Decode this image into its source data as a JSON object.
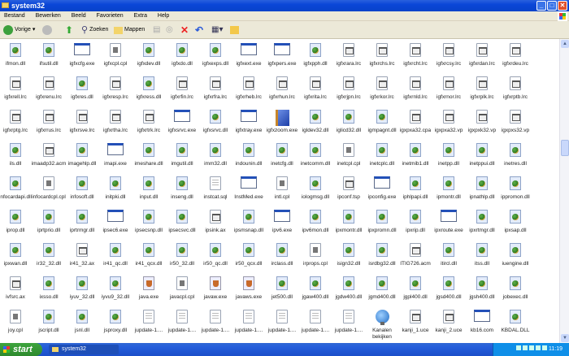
{
  "window": {
    "title": "system32"
  },
  "menu": [
    "Bestand",
    "Bewerken",
    "Beeld",
    "Favorieten",
    "Extra",
    "Help"
  ],
  "toolbar": {
    "back": "Vorige",
    "search": "Zoeken",
    "folders": "Mappen"
  },
  "taskbar": {
    "start": "start",
    "task": "system32",
    "clock": "11:19"
  },
  "rows": [
    [
      [
        "ifmon.dll",
        "dll"
      ],
      [
        "ifsutil.dll",
        "dll"
      ],
      [
        "igfxcfg.exe",
        "exe"
      ],
      [
        "igfxcpl.cpl",
        "cpl"
      ],
      [
        "igfxdev.dll",
        "dll"
      ],
      [
        "igfxdo.dll",
        "dll"
      ],
      [
        "igfxexps.dll",
        "dll"
      ],
      [
        "igfxext.exe",
        "exe"
      ],
      [
        "igfxpers.exe",
        "exe"
      ],
      [
        "igfxpph.dll",
        "dll"
      ],
      [
        "igfxrara.lrc",
        "lrc"
      ],
      [
        "igfxrchs.lrc",
        "lrc"
      ],
      [
        "igfxrcht.lrc",
        "lrc"
      ],
      [
        "igfxrcsy.lrc",
        "lrc"
      ],
      [
        "igfxrdan.lrc",
        "lrc"
      ],
      [
        "igfxrdeu.lrc",
        "lrc"
      ]
    ],
    [
      [
        "igfxrell.lrc",
        "lrc"
      ],
      [
        "igfxrenu.lrc",
        "lrc"
      ],
      [
        "igfxres.dll",
        "dll"
      ],
      [
        "igfxresp.lrc",
        "lrc"
      ],
      [
        "igfxress.dll",
        "dll"
      ],
      [
        "igfxrfin.lrc",
        "lrc"
      ],
      [
        "igfxrfra.lrc",
        "lrc"
      ],
      [
        "igfxrheb.lrc",
        "lrc"
      ],
      [
        "igfxrhun.lrc",
        "lrc"
      ],
      [
        "igfxrita.lrc",
        "lrc"
      ],
      [
        "igfxrjpn.lrc",
        "lrc"
      ],
      [
        "igfxrkor.lrc",
        "lrc"
      ],
      [
        "igfxrnld.lrc",
        "lrc"
      ],
      [
        "igfxrnor.lrc",
        "lrc"
      ],
      [
        "igfxrplk.lrc",
        "lrc"
      ],
      [
        "igfxrptb.lrc",
        "lrc"
      ]
    ],
    [
      [
        "igfxrptg.lrc",
        "lrc"
      ],
      [
        "igfxrrus.lrc",
        "lrc"
      ],
      [
        "igfxrsve.lrc",
        "lrc"
      ],
      [
        "igfxrtha.lrc",
        "lrc"
      ],
      [
        "igfxrtrk.lrc",
        "lrc"
      ],
      [
        "igfxsrvc.exe",
        "exe"
      ],
      [
        "igfxsrvc.dll",
        "dll"
      ],
      [
        "igfxtray.exe",
        "exe"
      ],
      [
        "igfxzoom.exe",
        "zoom"
      ],
      [
        "igldev32.dll",
        "dll"
      ],
      [
        "iglicd32.dll",
        "dll"
      ],
      [
        "igmpagnt.dll",
        "dll"
      ],
      [
        "igxpxa32.cpa",
        "lrc"
      ],
      [
        "igxpxa32.vp",
        "lrc"
      ],
      [
        "igxpxk32.vp",
        "lrc"
      ],
      [
        "igxpxs32.vp",
        "lrc"
      ]
    ],
    [
      [
        "ils.dll",
        "dll"
      ],
      [
        "imaadp32.acm",
        "lrc"
      ],
      [
        "imagehlp.dll",
        "dll"
      ],
      [
        "imapi.exe",
        "exe"
      ],
      [
        "imeshare.dll",
        "dll"
      ],
      [
        "imgutil.dll",
        "dll"
      ],
      [
        "imm32.dll",
        "dll"
      ],
      [
        "indounin.dll",
        "dll"
      ],
      [
        "inetcfg.dll",
        "dll"
      ],
      [
        "inetcomm.dll",
        "dll"
      ],
      [
        "inetcpl.cpl",
        "cpl"
      ],
      [
        "inetcplc.dll",
        "dll"
      ],
      [
        "inetmib1.dll",
        "dll"
      ],
      [
        "inetpp.dll",
        "dll"
      ],
      [
        "inetppui.dll",
        "dll"
      ],
      [
        "inetres.dll",
        "dll"
      ]
    ],
    [
      [
        "infocardapi.dll",
        "dll"
      ],
      [
        "infocardcpl.cpl",
        "cpl"
      ],
      [
        "infosoft.dll",
        "dll"
      ],
      [
        "initpki.dll",
        "dll"
      ],
      [
        "input.dll",
        "dll"
      ],
      [
        "inseng.dll",
        "dll"
      ],
      [
        "instcat.sql",
        "sql"
      ],
      [
        "InstMed.exe",
        "exe"
      ],
      [
        "intl.cpl",
        "cpl"
      ],
      [
        "iologmsg.dll",
        "dll"
      ],
      [
        "ipconf.tsp",
        "lrc"
      ],
      [
        "ipconfig.exe",
        "exe"
      ],
      [
        "iphlpapi.dll",
        "dll"
      ],
      [
        "ipmontr.dll",
        "dll"
      ],
      [
        "ipnathlp.dll",
        "dll"
      ],
      [
        "ippromon.dll",
        "dll"
      ]
    ],
    [
      [
        "iprop.dll",
        "dll"
      ],
      [
        "iprtprio.dll",
        "dll"
      ],
      [
        "iprtrmgr.dll",
        "dll"
      ],
      [
        "ipsec6.exe",
        "exe"
      ],
      [
        "ipsecsnp.dll",
        "dll"
      ],
      [
        "ipsecsvc.dll",
        "dll"
      ],
      [
        "ipsink.ax",
        "lrc"
      ],
      [
        "ipsmsnap.dll",
        "dll"
      ],
      [
        "ipv6.exe",
        "exe"
      ],
      [
        "ipv6mon.dll",
        "dll"
      ],
      [
        "ipxmontr.dll",
        "dll"
      ],
      [
        "ipxpromn.dll",
        "dll"
      ],
      [
        "ipxrip.dll",
        "dll"
      ],
      [
        "ipxroute.exe",
        "exe"
      ],
      [
        "ipxrtmgr.dll",
        "dll"
      ],
      [
        "ipxsap.dll",
        "dll"
      ]
    ],
    [
      [
        "ipxwan.dll",
        "dll"
      ],
      [
        "ir32_32.dll",
        "dll"
      ],
      [
        "ir41_32.ax",
        "lrc"
      ],
      [
        "ir41_qc.dll",
        "dll"
      ],
      [
        "ir41_qcx.dll",
        "dll"
      ],
      [
        "ir50_32.dll",
        "dll"
      ],
      [
        "ir50_qc.dll",
        "dll"
      ],
      [
        "ir50_qcx.dll",
        "dll"
      ],
      [
        "irclass.dll",
        "dll"
      ],
      [
        "irprops.cpl",
        "cpl"
      ],
      [
        "isign32.dll",
        "dll"
      ],
      [
        "isrdbg32.dll",
        "dll"
      ],
      [
        "ITIG726.acm",
        "lrc"
      ],
      [
        "itircl.dll",
        "dll"
      ],
      [
        "itss.dll",
        "dll"
      ],
      [
        "iuengine.dll",
        "dll"
      ]
    ],
    [
      [
        "ivfsrc.ax",
        "lrc"
      ],
      [
        "ixsso.dll",
        "dll"
      ],
      [
        "iyuv_32.dll",
        "dll"
      ],
      [
        "iyvu9_32.dll",
        "dll"
      ],
      [
        "java.exe",
        "java"
      ],
      [
        "javacpl.cpl",
        "cpl"
      ],
      [
        "javaw.exe",
        "java"
      ],
      [
        "javaws.exe",
        "java"
      ],
      [
        "jet500.dll",
        "dll"
      ],
      [
        "jgaw400.dll",
        "dll"
      ],
      [
        "jgdw400.dll",
        "dll"
      ],
      [
        "jgmd400.dll",
        "dll"
      ],
      [
        "jgpl400.dll",
        "dll"
      ],
      [
        "jgsd400.dll",
        "dll"
      ],
      [
        "jgsh400.dll",
        "dll"
      ],
      [
        "jobexec.dll",
        "dll"
      ]
    ],
    [
      [
        "joy.cpl",
        "cpl"
      ],
      [
        "jscript.dll",
        "dll"
      ],
      [
        "jsnl.dll",
        "dll"
      ],
      [
        "jsproxy.dll",
        "dll"
      ],
      [
        "jupdate-1....",
        "txt"
      ],
      [
        "jupdate-1....",
        "txt"
      ],
      [
        "jupdate-1....",
        "txt"
      ],
      [
        "jupdate-1....",
        "txt"
      ],
      [
        "jupdate-1....",
        "txt"
      ],
      [
        "jupdate-1....",
        "txt"
      ],
      [
        "jupdate-1....",
        "txt"
      ],
      [
        "Kanalen bekijken",
        "channel"
      ],
      [
        "kanji_1.uce",
        "lrc"
      ],
      [
        "kanji_2.uce",
        "lrc"
      ],
      [
        "kb16.com",
        "exe"
      ],
      [
        "KBDAL.DLL",
        "dll"
      ]
    ]
  ]
}
